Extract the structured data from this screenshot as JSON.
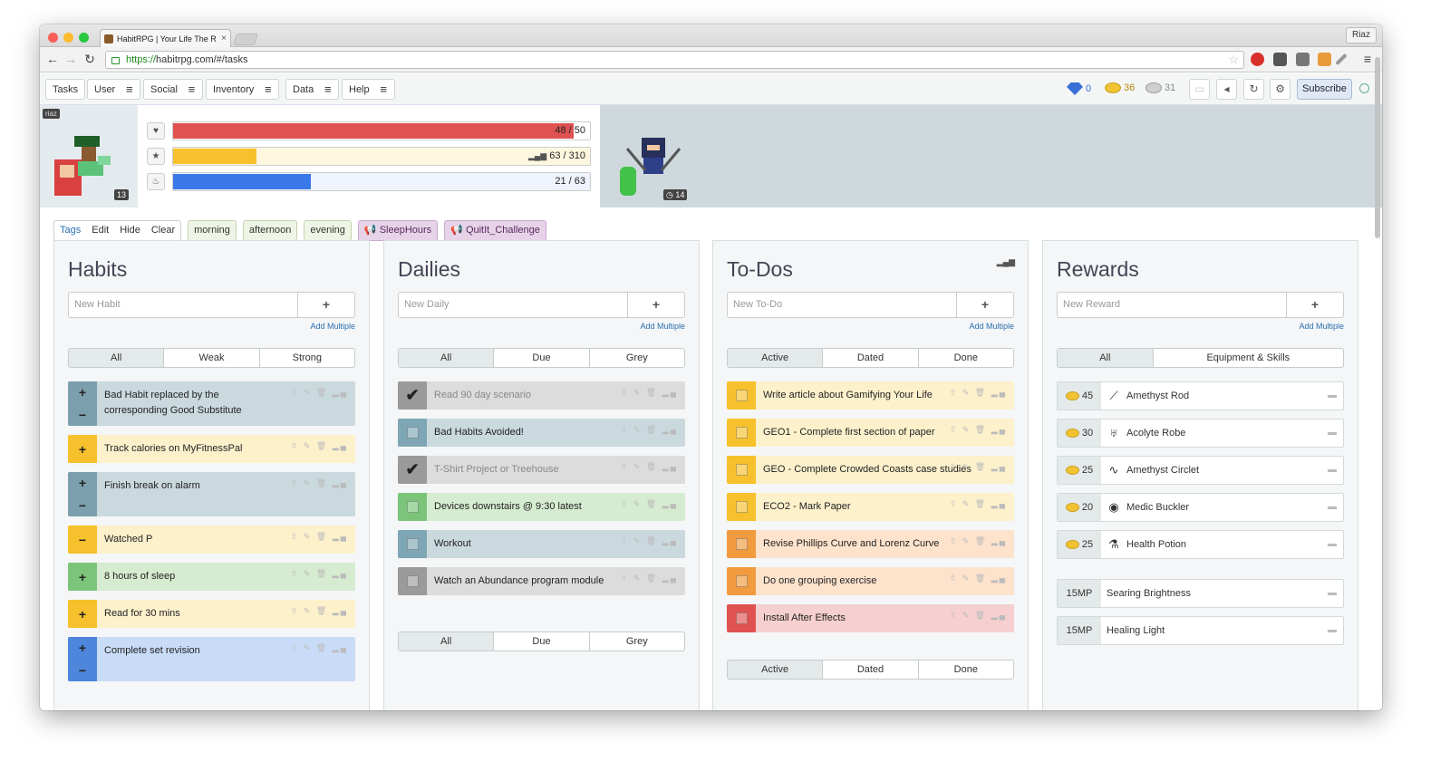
{
  "browser": {
    "tab_title": "HabitRPG | Your Life The R",
    "tab_close": "×",
    "profile_name": "Riaz",
    "url_https": "https://",
    "url_rest": "habitrpg.com/#/tasks"
  },
  "nav": {
    "tasks": "Tasks",
    "user": "User",
    "social": "Social",
    "inventory": "Inventory",
    "data": "Data",
    "help": "Help",
    "subscribe": "Subscribe",
    "gems": "0",
    "gold": "36",
    "silver": "31"
  },
  "player": {
    "username": "riaz",
    "level": "13",
    "hp": {
      "text": "48 / 50",
      "fill": 0.96,
      "color": "#e05252"
    },
    "xp": {
      "text": "63 / 310",
      "fill": 0.2,
      "color": "#f6c12c"
    },
    "mp": {
      "text": "21 / 63",
      "fill": 0.33,
      "color": "#3b78e7"
    },
    "party_level": "14"
  },
  "tags": {
    "label": "Tags",
    "edit": "Edit",
    "hide": "Hide",
    "clear": "Clear",
    "items": [
      "morning",
      "afternoon",
      "evening",
      "SleepHours",
      "QuitIt_Challenge"
    ]
  },
  "habits": {
    "title": "Habits",
    "placeholder": "New Habit",
    "add_multiple": "Add Multiple",
    "filters": [
      "All",
      "Weak",
      "Strong"
    ],
    "items": [
      {
        "text": "Bad Habit replaced by the corresponding Good Substitute",
        "color": "#cad9de",
        "ctl": "#7c9fae",
        "up": "+",
        "down": "−"
      },
      {
        "text": "Track calories on MyFitnessPal",
        "color": "#fdf1cc",
        "ctl": "#f6c12c",
        "up": "+"
      },
      {
        "text": "Finish break on alarm",
        "color": "#cad9de",
        "ctl": "#7c9fae",
        "up": "+",
        "down": "−"
      },
      {
        "text": "Watched P",
        "color": "#fdf1cc",
        "ctl": "#f6c12c",
        "up": "−"
      },
      {
        "text": "8 hours of sleep",
        "color": "#d6ecd0",
        "ctl": "#7cc47a",
        "up": "+"
      },
      {
        "text": "Read for 30 mins",
        "color": "#fdf1cc",
        "ctl": "#f6c12c",
        "up": "+"
      },
      {
        "text": "Complete set revision",
        "color": "#c9dcf7",
        "ctl": "#4d86db",
        "up": "+",
        "down": "−"
      }
    ]
  },
  "dailies": {
    "title": "Dailies",
    "placeholder": "New Daily",
    "add_multiple": "Add Multiple",
    "filters": [
      "All",
      "Due",
      "Grey"
    ],
    "items": [
      {
        "text": "Read 90 day scenario",
        "color": "#dcdcdc",
        "ctl": "#9a9a9a",
        "done": true
      },
      {
        "text": "Bad Habits Avoided!",
        "color": "#cad9de",
        "ctl": "#7fa6b4",
        "done": false
      },
      {
        "text": "T-Shirt Project or Treehouse",
        "color": "#dcdcdc",
        "ctl": "#9a9a9a",
        "done": true
      },
      {
        "text": "Devices downstairs @ 9:30 latest",
        "color": "#d6ecd0",
        "ctl": "#7cc47a",
        "done": false
      },
      {
        "text": "Workout",
        "color": "#cad9de",
        "ctl": "#7fa6b4",
        "done": false
      },
      {
        "text": "Watch an Abundance program module",
        "color": "#dcdcdc",
        "ctl": "#9a9a9a",
        "done": false
      }
    ],
    "bottom_filters": [
      "All",
      "Due",
      "Grey"
    ]
  },
  "todos": {
    "title": "To-Dos",
    "placeholder": "New To-Do",
    "add_multiple": "Add Multiple",
    "filters": [
      "Active",
      "Dated",
      "Done"
    ],
    "items": [
      {
        "text": "Write article about Gamifying Your Life",
        "color": "#fdf1cc",
        "ctl": "#f6c12c"
      },
      {
        "text": "GEO1 - Complete first section of paper",
        "color": "#fdf1cc",
        "ctl": "#f6c12c"
      },
      {
        "text": "GEO - Complete Crowded Coasts case studies",
        "color": "#fdf1cc",
        "ctl": "#f6c12c"
      },
      {
        "text": "ECO2 - Mark Paper",
        "color": "#fdf1cc",
        "ctl": "#f6c12c"
      },
      {
        "text": "Revise Phillips Curve and Lorenz Curve",
        "color": "#fde3cc",
        "ctl": "#f29a3e"
      },
      {
        "text": "Do one grouping exercise",
        "color": "#fde3cc",
        "ctl": "#f29a3e"
      },
      {
        "text": "Install After Effects",
        "color": "#f6d0d0",
        "ctl": "#e05252"
      }
    ],
    "bottom_filters": [
      "Active",
      "Dated",
      "Done"
    ]
  },
  "rewards": {
    "title": "Rewards",
    "placeholder": "New Reward",
    "add_multiple": "Add Multiple",
    "filters": [
      "All",
      "Equipment & Skills"
    ],
    "items": [
      {
        "cost": "45",
        "name": "Amethyst Rod",
        "icon": "wand-icon"
      },
      {
        "cost": "30",
        "name": "Acolyte Robe",
        "icon": "robe-icon"
      },
      {
        "cost": "25",
        "name": "Amethyst Circlet",
        "icon": "circlet-icon"
      },
      {
        "cost": "20",
        "name": "Medic Buckler",
        "icon": "shield-icon"
      },
      {
        "cost": "25",
        "name": "Health Potion",
        "icon": "potion-icon"
      }
    ],
    "skills": [
      {
        "cost": "15MP",
        "name": "Searing Brightness"
      },
      {
        "cost": "15MP",
        "name": "Healing Light"
      }
    ]
  }
}
